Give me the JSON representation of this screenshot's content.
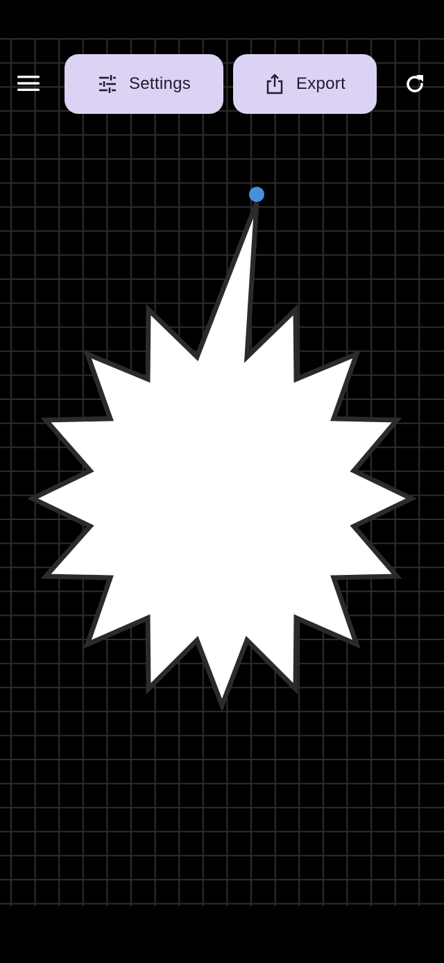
{
  "toolbar": {
    "menu_icon": "menu-icon",
    "settings": {
      "label": "Settings",
      "icon": "sliders-icon"
    },
    "export": {
      "label": "Export",
      "icon": "share-upload-icon"
    },
    "refresh_icon": "refresh-icon"
  },
  "canvas": {
    "background": "#000000",
    "grid_color": "#2E2E2E",
    "shape": {
      "type": "starburst",
      "fill": "#FFFFFF",
      "stroke": "#2B2B2B"
    },
    "control_handle_color": "#4A90D9"
  },
  "colors": {
    "pill_background": "#DCD3F4",
    "pill_text": "#1F1A2E",
    "icon_white": "#FFFFFF"
  }
}
